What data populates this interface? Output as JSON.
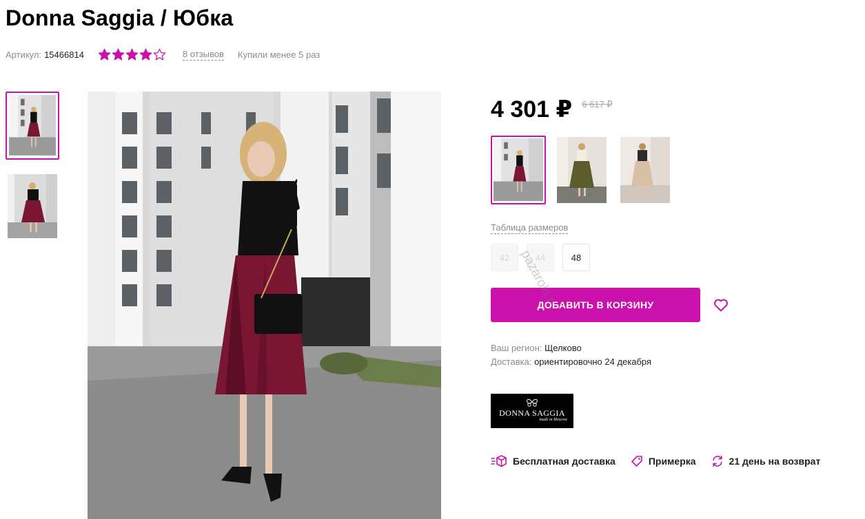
{
  "product": {
    "title": "Donna Saggia / Юбка",
    "article_label": "Артикул:",
    "article_value": "15466814",
    "rating": 4,
    "rating_max": 5,
    "reviews": "8 отзывов",
    "bought": "Купили менее 5 раз"
  },
  "price": {
    "current": "4 301 ₽",
    "old": "6 617 ₽"
  },
  "sizes": {
    "table_link": "Таблица размеров",
    "items": [
      {
        "label": "42",
        "available": false
      },
      {
        "label": "44",
        "available": false
      },
      {
        "label": "48",
        "available": true
      }
    ]
  },
  "cart": {
    "button": "ДОБАВИТЬ В КОРЗИНУ"
  },
  "delivery": {
    "region_label": "Ваш регион:",
    "region_value": "Щелково",
    "delivery_label": "Доставка:",
    "delivery_value": "ориентировочно 24 декабря"
  },
  "brand": {
    "logo_name": "DONNA SAGGIA",
    "logo_sub": "made in Moscow"
  },
  "features": [
    {
      "label": "Бесплатная доставка",
      "icon": "free-delivery-icon"
    },
    {
      "label": "Примерка",
      "icon": "tag-icon"
    },
    {
      "label": "21 день на возврат",
      "icon": "return-icon"
    }
  ],
  "watermark": "pazaroki.ru",
  "colors": {
    "accent": "#cb11ab",
    "text_muted": "#8b8b8b",
    "skirt_burgundy": "#7a1532",
    "skirt_olive": "#5a5c2e",
    "skirt_beige": "#d9c0a4"
  }
}
